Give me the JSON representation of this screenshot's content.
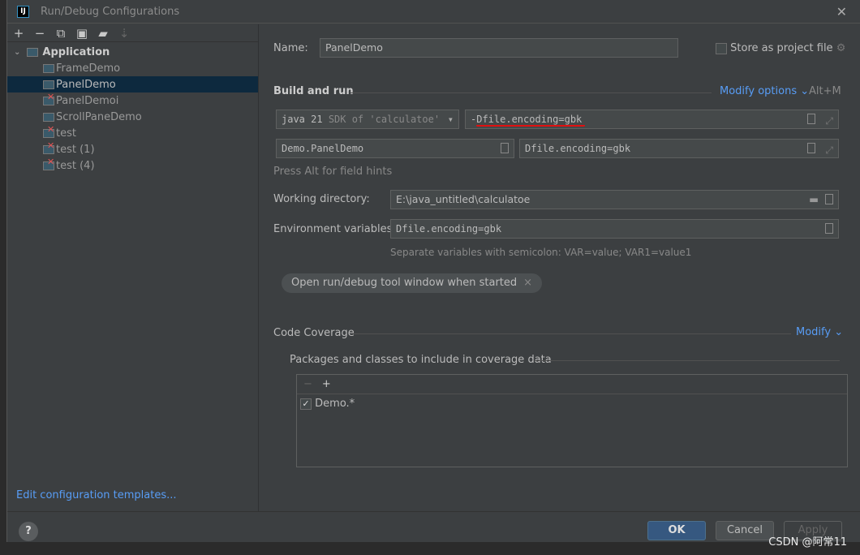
{
  "window": {
    "title": "Run/Debug Configurations",
    "logo": "IJ"
  },
  "toolbar": {
    "icons": [
      "plus-icon",
      "minus-icon",
      "copy-icon",
      "save-icon",
      "new-folder-icon",
      "sort-icon"
    ]
  },
  "tree": {
    "root": "Application",
    "items": [
      {
        "label": "FrameDemo",
        "error": false
      },
      {
        "label": "PanelDemo",
        "error": false,
        "selected": true
      },
      {
        "label": "PanelDemoi",
        "error": true
      },
      {
        "label": "ScrollPaneDemo",
        "error": false
      },
      {
        "label": "test",
        "error": true
      },
      {
        "label": "test (1)",
        "error": true
      },
      {
        "label": "test (4)",
        "error": true
      }
    ]
  },
  "edit_templates": "Edit configuration templates...",
  "form": {
    "name_label": "Name:",
    "name_value": "PanelDemo",
    "store_label": "Store as project file",
    "build_run": "Build and run",
    "modify_options": "Modify options",
    "modify_shortcut": "Alt+M",
    "sdk_main": "java 21",
    "sdk_sub": "SDK of 'calculatoe'",
    "vm_options": "-Dfile.encoding=gbk",
    "main_class": "Demo.PanelDemo",
    "program_args": "Dfile.encoding=gbk",
    "field_hint": "Press Alt for field hints",
    "workdir_label": "Working directory:",
    "workdir_value": "E:\\java_untitled\\calculatoe",
    "env_label": "Environment variables:",
    "env_value": "Dfile.encoding=gbk",
    "env_hint": "Separate variables with semicolon: VAR=value; VAR1=value1",
    "chip": "Open run/debug tool window when started",
    "coverage": "Code Coverage",
    "coverage_modify": "Modify",
    "packages_label": "Packages and classes to include in coverage data",
    "packages": [
      {
        "label": "Demo.*",
        "checked": true
      }
    ]
  },
  "buttons": {
    "help": "?",
    "ok": "OK",
    "cancel": "Cancel",
    "apply": "Apply"
  },
  "watermark": "CSDN @阿常11",
  "colors": {
    "accent": "#589df6",
    "selection": "#0d293e",
    "ok": "#365880",
    "error": "#e05555"
  }
}
